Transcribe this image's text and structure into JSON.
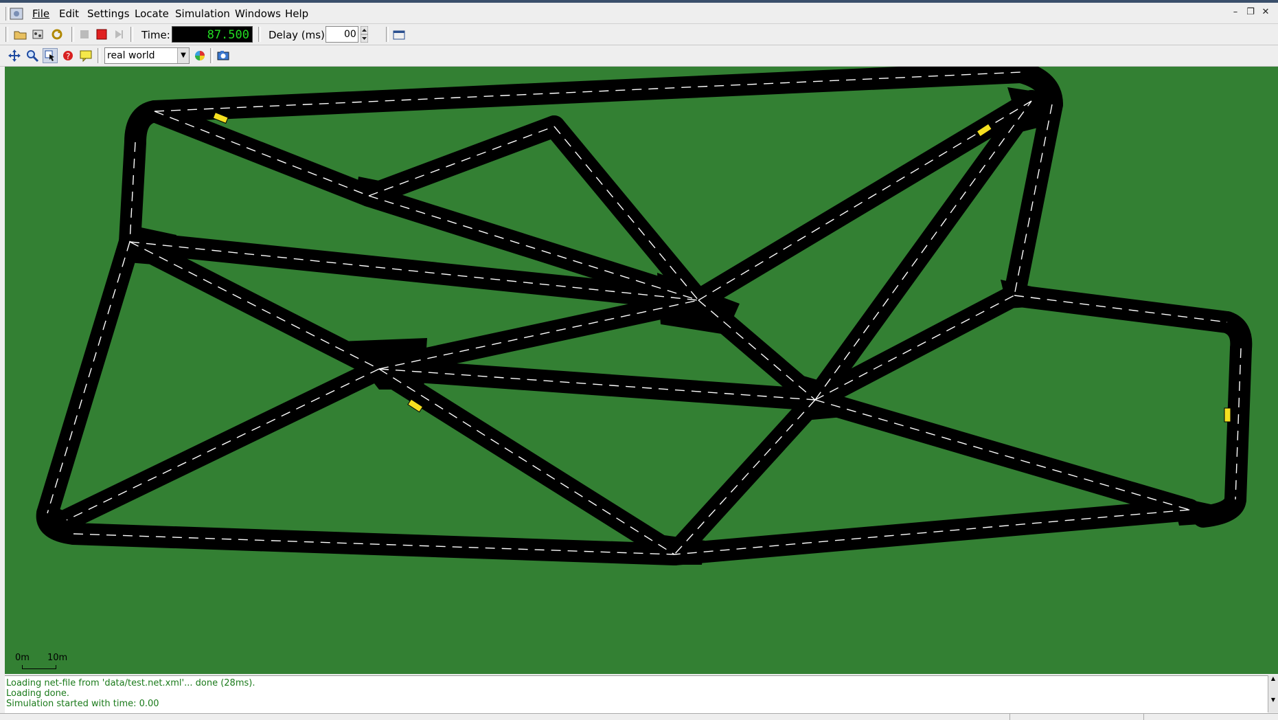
{
  "menubar": {
    "items": [
      "File",
      "Edit",
      "Settings",
      "Locate",
      "Simulation",
      "Windows",
      "Help"
    ]
  },
  "toolbar": {
    "time_label": "Time:",
    "time_value": "87.500",
    "delay_label": "Delay (ms):",
    "delay_value": "00",
    "viewport_scheme": "real world"
  },
  "canvas": {
    "background_color": "#338033",
    "road_color": "#000000",
    "vehicle_color": "#f5e020",
    "scale_start": "0m",
    "scale_end": "10m"
  },
  "log": {
    "lines": [
      "Loading net-file from 'data/test.net.xml'...  done (28ms).",
      "Loading done.",
      "Simulation started with time: 0.00"
    ]
  },
  "colors": {
    "log_text": "#1a7a1a",
    "time_digits": "#22dd22"
  }
}
